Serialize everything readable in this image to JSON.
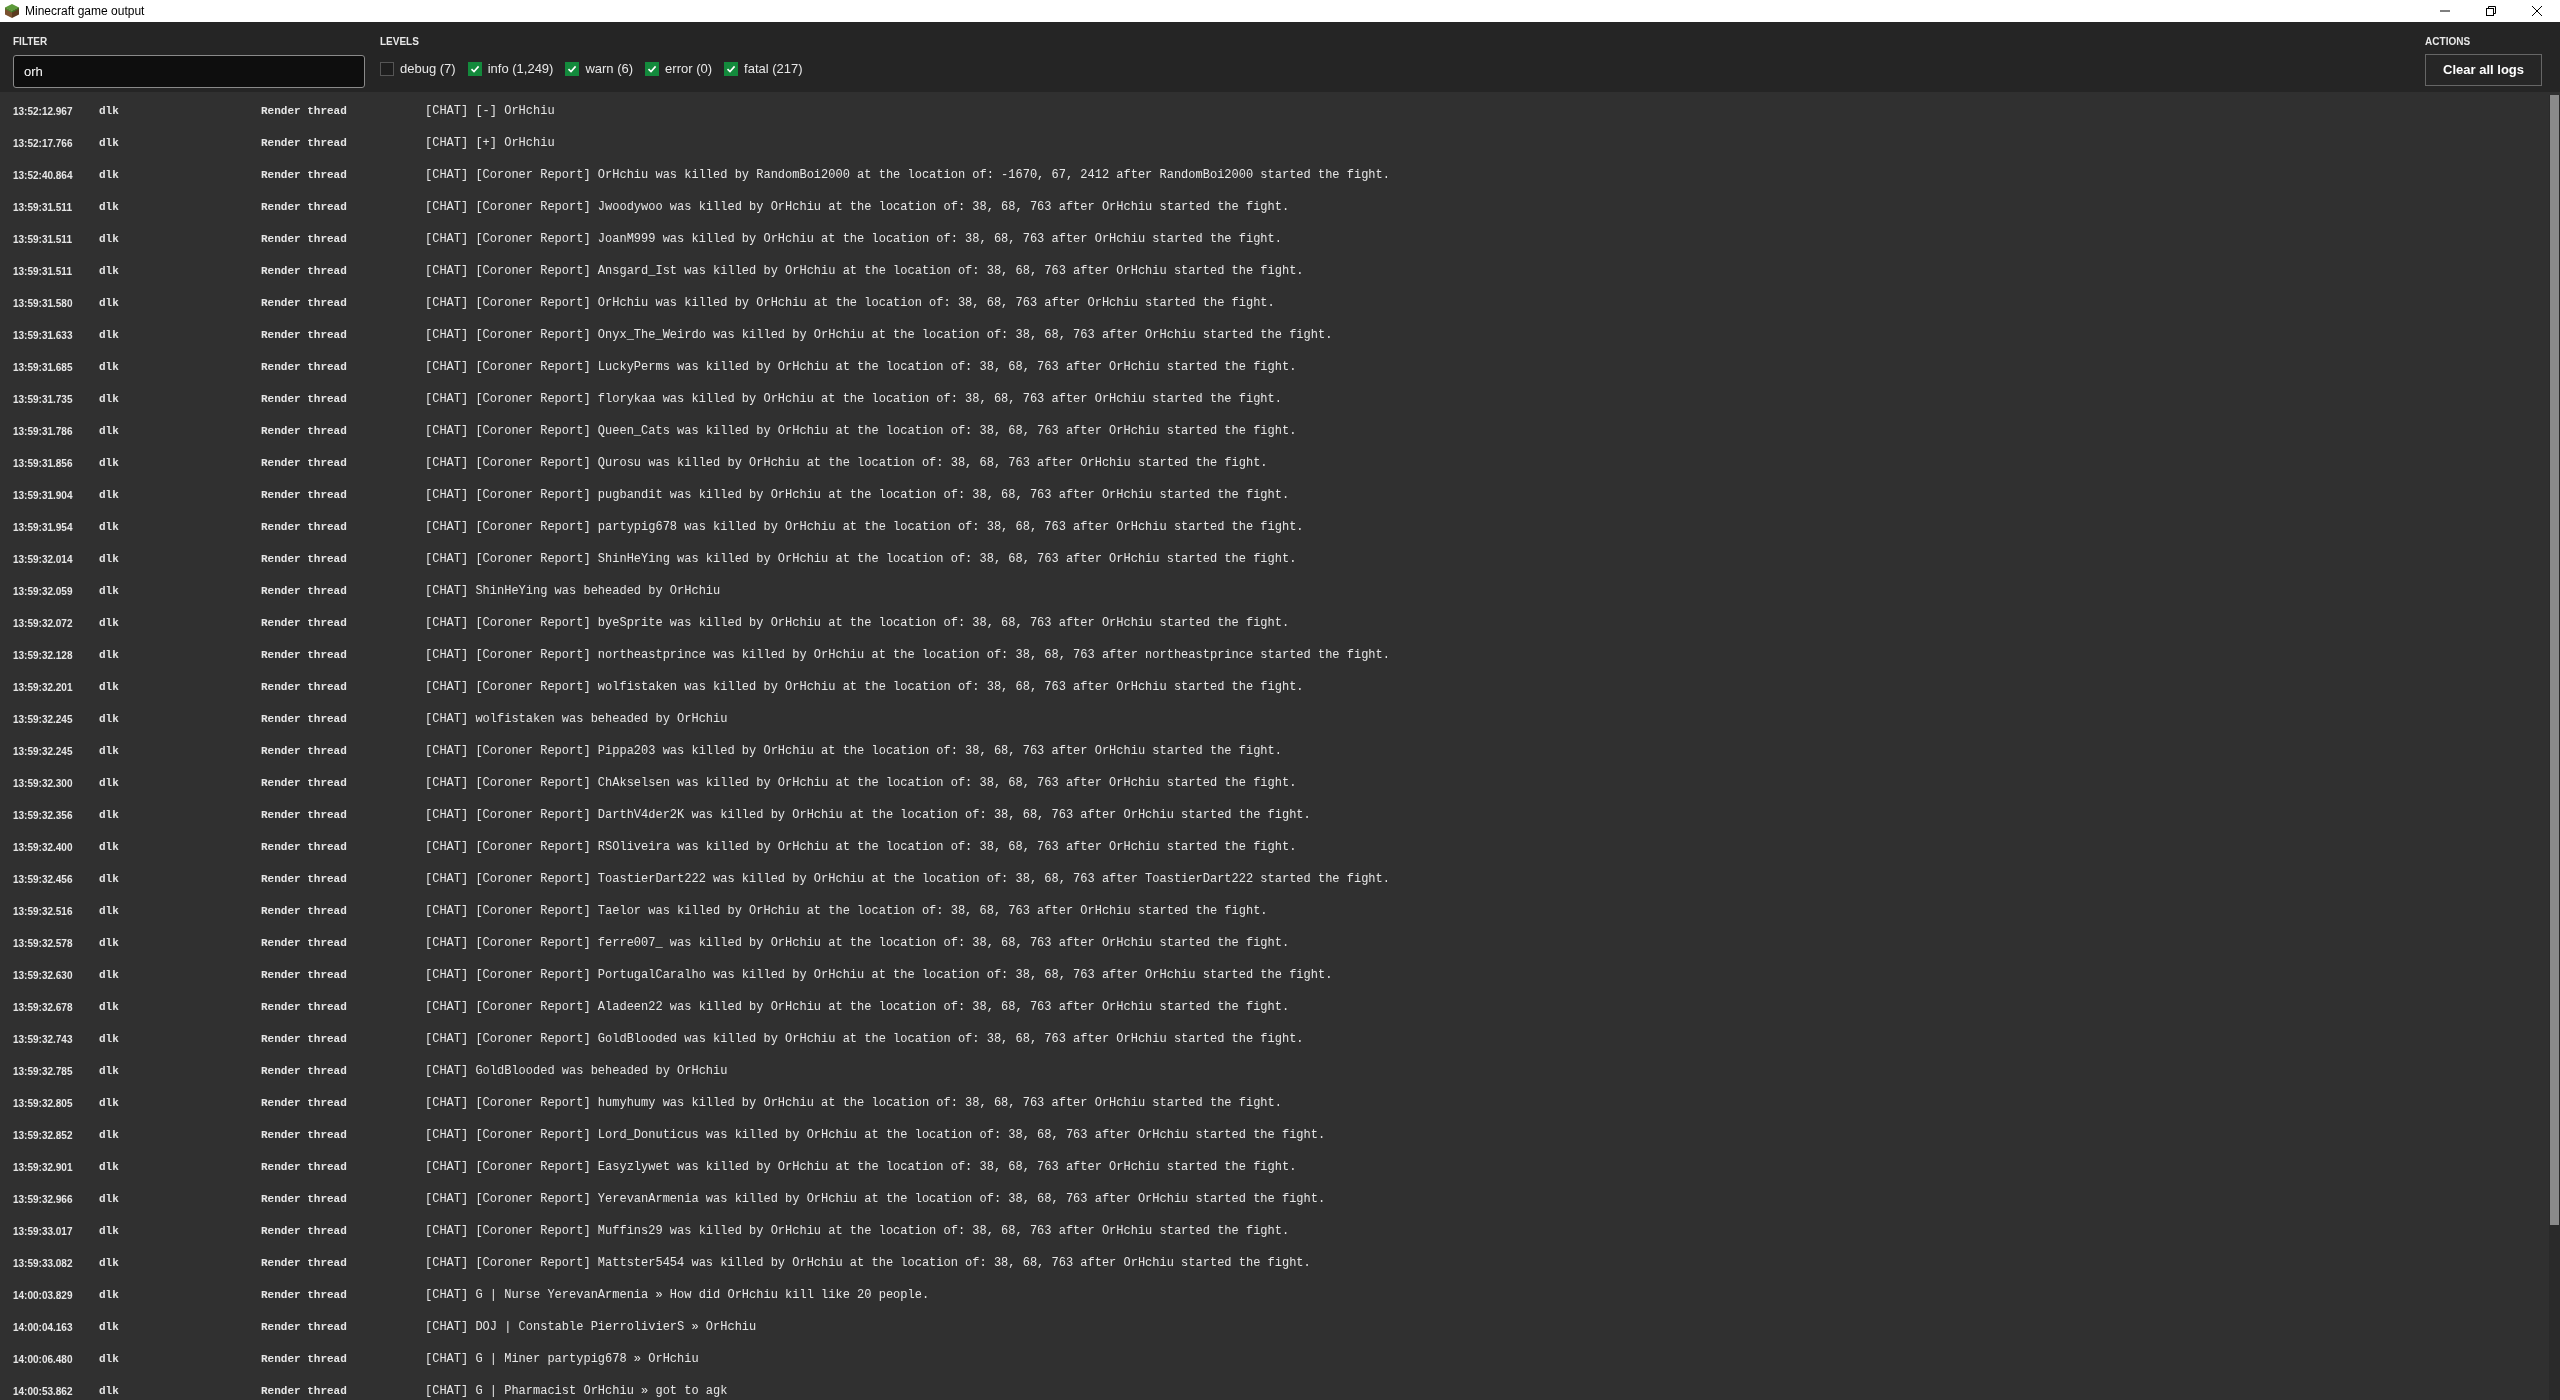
{
  "window": {
    "title": "Minecraft game output"
  },
  "filter": {
    "label": "FILTER",
    "value": "orh"
  },
  "levels": {
    "label": "LEVELS",
    "items": [
      {
        "label": "debug (7)",
        "checked": false
      },
      {
        "label": "info (1,249)",
        "checked": true
      },
      {
        "label": "warn (6)",
        "checked": true
      },
      {
        "label": "error (0)",
        "checked": true
      },
      {
        "label": "fatal (217)",
        "checked": true
      }
    ]
  },
  "actions": {
    "label": "ACTIONS",
    "buttons": [
      "Clear all logs"
    ]
  },
  "log": [
    {
      "time": "13:52:12.967",
      "source": "dlk",
      "thread": "Render thread",
      "message": "[CHAT] [-] OrHchiu"
    },
    {
      "time": "13:52:17.766",
      "source": "dlk",
      "thread": "Render thread",
      "message": "[CHAT] [+] OrHchiu"
    },
    {
      "time": "13:52:40.864",
      "source": "dlk",
      "thread": "Render thread",
      "message": "[CHAT] [Coroner Report] OrHchiu was killed by RandomBoi2000 at the location of: -1670, 67, 2412 after RandomBoi2000 started the fight."
    },
    {
      "time": "13:59:31.511",
      "source": "dlk",
      "thread": "Render thread",
      "message": "[CHAT] [Coroner Report] Jwoodywoo was killed by OrHchiu at the location of: 38, 68, 763 after OrHchiu started the fight."
    },
    {
      "time": "13:59:31.511",
      "source": "dlk",
      "thread": "Render thread",
      "message": "[CHAT] [Coroner Report] JoanM999 was killed by OrHchiu at the location of: 38, 68, 763 after OrHchiu started the fight."
    },
    {
      "time": "13:59:31.511",
      "source": "dlk",
      "thread": "Render thread",
      "message": "[CHAT] [Coroner Report] Ansgard_Ist was killed by OrHchiu at the location of: 38, 68, 763 after OrHchiu started the fight."
    },
    {
      "time": "13:59:31.580",
      "source": "dlk",
      "thread": "Render thread",
      "message": "[CHAT] [Coroner Report] OrHchiu was killed by OrHchiu at the location of: 38, 68, 763 after OrHchiu started the fight."
    },
    {
      "time": "13:59:31.633",
      "source": "dlk",
      "thread": "Render thread",
      "message": "[CHAT] [Coroner Report] Onyx_The_Weirdo was killed by OrHchiu at the location of: 38, 68, 763 after OrHchiu started the fight."
    },
    {
      "time": "13:59:31.685",
      "source": "dlk",
      "thread": "Render thread",
      "message": "[CHAT] [Coroner Report] LuckyPerms was killed by OrHchiu at the location of: 38, 68, 763 after OrHchiu started the fight."
    },
    {
      "time": "13:59:31.735",
      "source": "dlk",
      "thread": "Render thread",
      "message": "[CHAT] [Coroner Report] florykaa was killed by OrHchiu at the location of: 38, 68, 763 after OrHchiu started the fight."
    },
    {
      "time": "13:59:31.786",
      "source": "dlk",
      "thread": "Render thread",
      "message": "[CHAT] [Coroner Report] Queen_Cats was killed by OrHchiu at the location of: 38, 68, 763 after OrHchiu started the fight."
    },
    {
      "time": "13:59:31.856",
      "source": "dlk",
      "thread": "Render thread",
      "message": "[CHAT] [Coroner Report] Qurosu was killed by OrHchiu at the location of: 38, 68, 763 after OrHchiu started the fight."
    },
    {
      "time": "13:59:31.904",
      "source": "dlk",
      "thread": "Render thread",
      "message": "[CHAT] [Coroner Report] pugbandit was killed by OrHchiu at the location of: 38, 68, 763 after OrHchiu started the fight."
    },
    {
      "time": "13:59:31.954",
      "source": "dlk",
      "thread": "Render thread",
      "message": "[CHAT] [Coroner Report] partypig678 was killed by OrHchiu at the location of: 38, 68, 763 after OrHchiu started the fight."
    },
    {
      "time": "13:59:32.014",
      "source": "dlk",
      "thread": "Render thread",
      "message": "[CHAT] [Coroner Report] ShinHeYing was killed by OrHchiu at the location of: 38, 68, 763 after OrHchiu started the fight."
    },
    {
      "time": "13:59:32.059",
      "source": "dlk",
      "thread": "Render thread",
      "message": "[CHAT] ShinHeYing was beheaded by OrHchiu"
    },
    {
      "time": "13:59:32.072",
      "source": "dlk",
      "thread": "Render thread",
      "message": "[CHAT] [Coroner Report] byeSprite was killed by OrHchiu at the location of: 38, 68, 763 after OrHchiu started the fight."
    },
    {
      "time": "13:59:32.128",
      "source": "dlk",
      "thread": "Render thread",
      "message": "[CHAT] [Coroner Report] northeastprince was killed by OrHchiu at the location of: 38, 68, 763 after northeastprince started the fight."
    },
    {
      "time": "13:59:32.201",
      "source": "dlk",
      "thread": "Render thread",
      "message": "[CHAT] [Coroner Report] wolfistaken was killed by OrHchiu at the location of: 38, 68, 763 after OrHchiu started the fight."
    },
    {
      "time": "13:59:32.245",
      "source": "dlk",
      "thread": "Render thread",
      "message": "[CHAT] wolfistaken was beheaded by OrHchiu"
    },
    {
      "time": "13:59:32.245",
      "source": "dlk",
      "thread": "Render thread",
      "message": "[CHAT] [Coroner Report] Pippa203 was killed by OrHchiu at the location of: 38, 68, 763 after OrHchiu started the fight."
    },
    {
      "time": "13:59:32.300",
      "source": "dlk",
      "thread": "Render thread",
      "message": "[CHAT] [Coroner Report] ChAkselsen was killed by OrHchiu at the location of: 38, 68, 763 after OrHchiu started the fight."
    },
    {
      "time": "13:59:32.356",
      "source": "dlk",
      "thread": "Render thread",
      "message": "[CHAT] [Coroner Report] DarthV4der2K was killed by OrHchiu at the location of: 38, 68, 763 after OrHchiu started the fight."
    },
    {
      "time": "13:59:32.400",
      "source": "dlk",
      "thread": "Render thread",
      "message": "[CHAT] [Coroner Report] RSOliveira was killed by OrHchiu at the location of: 38, 68, 763 after OrHchiu started the fight."
    },
    {
      "time": "13:59:32.456",
      "source": "dlk",
      "thread": "Render thread",
      "message": "[CHAT] [Coroner Report] ToastierDart222 was killed by OrHchiu at the location of: 38, 68, 763 after ToastierDart222 started the fight."
    },
    {
      "time": "13:59:32.516",
      "source": "dlk",
      "thread": "Render thread",
      "message": "[CHAT] [Coroner Report] Taelor was killed by OrHchiu at the location of: 38, 68, 763 after OrHchiu started the fight."
    },
    {
      "time": "13:59:32.578",
      "source": "dlk",
      "thread": "Render thread",
      "message": "[CHAT] [Coroner Report] ferre007_ was killed by OrHchiu at the location of: 38, 68, 763 after OrHchiu started the fight."
    },
    {
      "time": "13:59:32.630",
      "source": "dlk",
      "thread": "Render thread",
      "message": "[CHAT] [Coroner Report] PortugalCaralho was killed by OrHchiu at the location of: 38, 68, 763 after OrHchiu started the fight."
    },
    {
      "time": "13:59:32.678",
      "source": "dlk",
      "thread": "Render thread",
      "message": "[CHAT] [Coroner Report] Aladeen22 was killed by OrHchiu at the location of: 38, 68, 763 after OrHchiu started the fight."
    },
    {
      "time": "13:59:32.743",
      "source": "dlk",
      "thread": "Render thread",
      "message": "[CHAT] [Coroner Report] GoldBlooded was killed by OrHchiu at the location of: 38, 68, 763 after OrHchiu started the fight."
    },
    {
      "time": "13:59:32.785",
      "source": "dlk",
      "thread": "Render thread",
      "message": "[CHAT] GoldBlooded was beheaded by OrHchiu"
    },
    {
      "time": "13:59:32.805",
      "source": "dlk",
      "thread": "Render thread",
      "message": "[CHAT] [Coroner Report] humyhumy was killed by OrHchiu at the location of: 38, 68, 763 after OrHchiu started the fight."
    },
    {
      "time": "13:59:32.852",
      "source": "dlk",
      "thread": "Render thread",
      "message": "[CHAT] [Coroner Report] Lord_Donuticus was killed by OrHchiu at the location of: 38, 68, 763 after OrHchiu started the fight."
    },
    {
      "time": "13:59:32.901",
      "source": "dlk",
      "thread": "Render thread",
      "message": "[CHAT] [Coroner Report] Easyzlywet was killed by OrHchiu at the location of: 38, 68, 763 after OrHchiu started the fight."
    },
    {
      "time": "13:59:32.966",
      "source": "dlk",
      "thread": "Render thread",
      "message": "[CHAT] [Coroner Report] YerevanArmenia was killed by OrHchiu at the location of: 38, 68, 763 after OrHchiu started the fight."
    },
    {
      "time": "13:59:33.017",
      "source": "dlk",
      "thread": "Render thread",
      "message": "[CHAT] [Coroner Report] Muffins29 was killed by OrHchiu at the location of: 38, 68, 763 after OrHchiu started the fight."
    },
    {
      "time": "13:59:33.082",
      "source": "dlk",
      "thread": "Render thread",
      "message": "[CHAT] [Coroner Report] Mattster5454 was killed by OrHchiu at the location of: 38, 68, 763 after OrHchiu started the fight."
    },
    {
      "time": "14:00:03.829",
      "source": "dlk",
      "thread": "Render thread",
      "message": "[CHAT] G | Nurse YerevanArmenia » How did OrHchiu kill like 20 people."
    },
    {
      "time": "14:00:04.163",
      "source": "dlk",
      "thread": "Render thread",
      "message": "[CHAT] DOJ | Constable PierrolivierS » OrHchiu"
    },
    {
      "time": "14:00:06.480",
      "source": "dlk",
      "thread": "Render thread",
      "message": "[CHAT] G | Miner partypig678 » OrHchiu"
    },
    {
      "time": "14:00:53.862",
      "source": "dlk",
      "thread": "Render thread",
      "message": "[CHAT] G | Pharmacist OrHchiu » got to agk"
    }
  ]
}
